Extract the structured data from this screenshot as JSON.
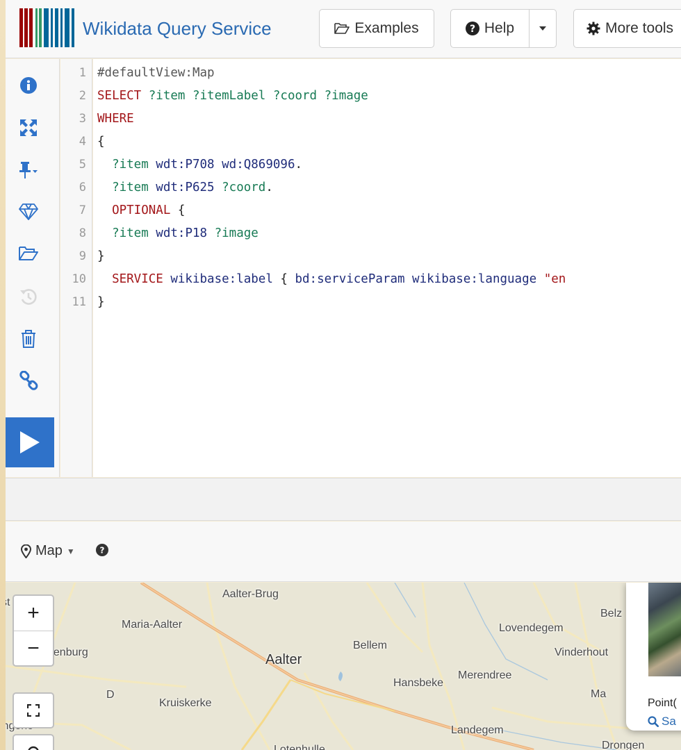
{
  "app": {
    "title": "Wikidata Query Service",
    "brand_color": "#2a6ab2"
  },
  "navbar": {
    "examples_label": "Examples",
    "help_label": "Help",
    "more_tools_label": "More tools"
  },
  "toolbar": {
    "icons": [
      "info-icon",
      "expand-icon",
      "pin-icon",
      "gem-icon",
      "folder-open-icon",
      "history-icon",
      "trash-icon",
      "link-icon"
    ],
    "run_icon": "play-icon",
    "run_color": "#2f72c9"
  },
  "editor": {
    "line_numbers": [
      "1",
      "2",
      "3",
      "4",
      "5",
      "6",
      "7",
      "8",
      "9",
      "10",
      "11"
    ],
    "lines": [
      [
        {
          "t": "#defaultView:Map",
          "c": "comment"
        }
      ],
      [
        {
          "t": "SELECT ",
          "c": "kw"
        },
        {
          "t": "?item ?itemLabel ?coord ?image",
          "c": "var"
        }
      ],
      [
        {
          "t": "WHERE",
          "c": "kw"
        }
      ],
      [
        {
          "t": "{",
          "c": "plain"
        }
      ],
      [
        {
          "t": "  ?item ",
          "c": "var"
        },
        {
          "t": "wdt:P708 wd:Q869096",
          "c": "iri"
        },
        {
          "t": ".",
          "c": "plain"
        }
      ],
      [
        {
          "t": "  ?item ",
          "c": "var"
        },
        {
          "t": "wdt:P625 ",
          "c": "iri"
        },
        {
          "t": "?coord",
          "c": "var"
        },
        {
          "t": ".",
          "c": "plain"
        }
      ],
      [
        {
          "t": "  OPTIONAL ",
          "c": "kw"
        },
        {
          "t": "{",
          "c": "plain"
        }
      ],
      [
        {
          "t": "  ?item ",
          "c": "var"
        },
        {
          "t": "wdt:P18 ",
          "c": "iri"
        },
        {
          "t": "?image",
          "c": "var"
        }
      ],
      [
        {
          "t": "}",
          "c": "plain"
        }
      ],
      [
        {
          "t": "  SERVICE ",
          "c": "kw"
        },
        {
          "t": "wikibase:label ",
          "c": "iri"
        },
        {
          "t": "{ ",
          "c": "plain"
        },
        {
          "t": "bd:serviceParam wikibase:language ",
          "c": "iri"
        },
        {
          "t": "\"en",
          "c": "str"
        }
      ],
      [
        {
          "t": "}",
          "c": "plain"
        }
      ]
    ]
  },
  "results": {
    "view_label": "Map",
    "view_icon": "map-marker-icon",
    "help_icon": "question-circle-icon"
  },
  "map": {
    "zoom_in": "+",
    "zoom_out": "−",
    "places": [
      "Aalter-Brug",
      "Maria-Aalter",
      "Belz",
      "Lovendegem",
      "denburg",
      "Bellem",
      "Aalter",
      "Vinderhout",
      "Merendree",
      "Hansbeke",
      "D",
      "Kruiskerke",
      "Ma",
      "ingene",
      "Landegem",
      "Lotenhulle",
      "Drongen",
      "st"
    ],
    "popup": {
      "point_text": "Point(",
      "search_label": "Sa"
    }
  }
}
